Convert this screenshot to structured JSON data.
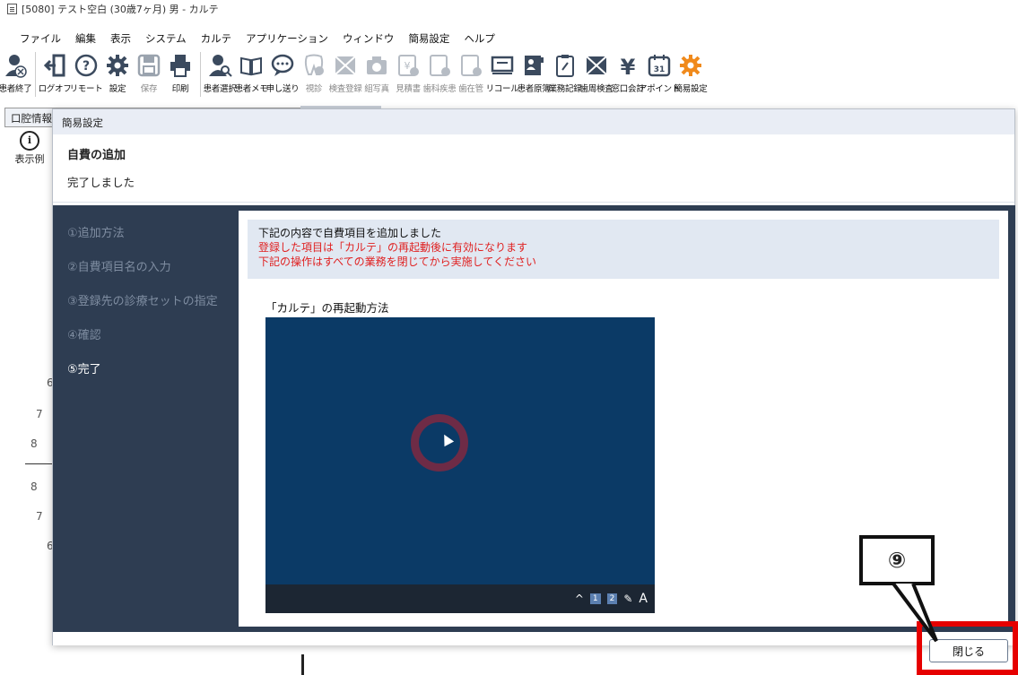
{
  "window": {
    "title": "[5080] テスト空白 (30歳7ヶ月) 男 - カルテ"
  },
  "menu": [
    "ファイル",
    "編集",
    "表示",
    "システム",
    "カルテ",
    "アプリケーション",
    "ウィンドウ",
    "簡易設定",
    "ヘルプ"
  ],
  "toolbar": [
    {
      "label": "患者終了",
      "icon": "patient-exit-icon",
      "enabled": true
    },
    {
      "label": "ログオフ",
      "icon": "logoff-icon",
      "enabled": true
    },
    {
      "label": "リモート",
      "icon": "remote-help-icon",
      "enabled": true
    },
    {
      "label": "設定",
      "icon": "gear-icon",
      "enabled": true
    },
    {
      "label": "保存",
      "icon": "save-icon",
      "enabled": false
    },
    {
      "label": "印刷",
      "icon": "printer-icon",
      "enabled": true
    },
    {
      "label": "患者選択",
      "icon": "patient-search-icon",
      "enabled": true
    },
    {
      "label": "患者メモ",
      "icon": "book-icon",
      "enabled": true
    },
    {
      "label": "申し送り",
      "icon": "speech-bubble-icon",
      "enabled": true
    },
    {
      "label": "視診",
      "icon": "tooth-icon",
      "enabled": false
    },
    {
      "label": "検査登録",
      "icon": "exam-icon",
      "enabled": false
    },
    {
      "label": "組写真",
      "icon": "camera-icon",
      "enabled": false
    },
    {
      "label": "見積書",
      "icon": "estimate-icon",
      "enabled": false
    },
    {
      "label": "歯科疾患",
      "icon": "dental-disease-icon",
      "enabled": false
    },
    {
      "label": "歯在管",
      "icon": "dental-manage-icon",
      "enabled": false
    },
    {
      "label": "リコール",
      "icon": "recall-icon",
      "enabled": true
    },
    {
      "label": "患者原簿",
      "icon": "patient-ledger-icon",
      "enabled": true
    },
    {
      "label": "業務記録",
      "icon": "clipboard-icon",
      "enabled": true
    },
    {
      "label": "歯周検査",
      "icon": "perio-exam-icon",
      "enabled": true
    },
    {
      "label": "窓口会計",
      "icon": "yen-icon",
      "enabled": true
    },
    {
      "label": "アポイント",
      "icon": "calendar-icon",
      "enabled": true
    },
    {
      "label": "簡易設定",
      "icon": "quick-settings-icon",
      "enabled": true
    }
  ],
  "background": {
    "panel_tab": "口腔情報",
    "info_label": "表示例",
    "tooth_labels": [
      "6",
      "7",
      "8",
      "8",
      "7",
      "6"
    ]
  },
  "dialog": {
    "title": "簡易設定",
    "heading": "自費の追加",
    "subheading": "完了しました",
    "steps": [
      {
        "label": "①追加方法",
        "active": false
      },
      {
        "label": "②自費項目名の入力",
        "active": false
      },
      {
        "label": "③登録先の診療セットの指定",
        "active": false
      },
      {
        "label": "④確認",
        "active": false
      },
      {
        "label": "⑤完了",
        "active": true
      }
    ],
    "notice_line1": "下記の内容で自費項目を追加しました",
    "notice_line2": "登録した項目は「カルテ」の再起動後に有効になります",
    "notice_line3": "下記の操作はすべての業務を閉じてから実施してください",
    "restart_label": "「カルテ」の再起動方法",
    "taskbar": {
      "caret": "^",
      "num1": "1",
      "num2": "2",
      "pen": "✎",
      "font": "A"
    },
    "close_label": "閉じる"
  },
  "callout": {
    "label": "⑨"
  },
  "colors": {
    "dialog_sidebar": "#2e3d52",
    "notice_bg": "#e1e8f2",
    "warning_text": "#e02020",
    "highlight": "#e60000",
    "preview_bg": "#0b3a66"
  }
}
